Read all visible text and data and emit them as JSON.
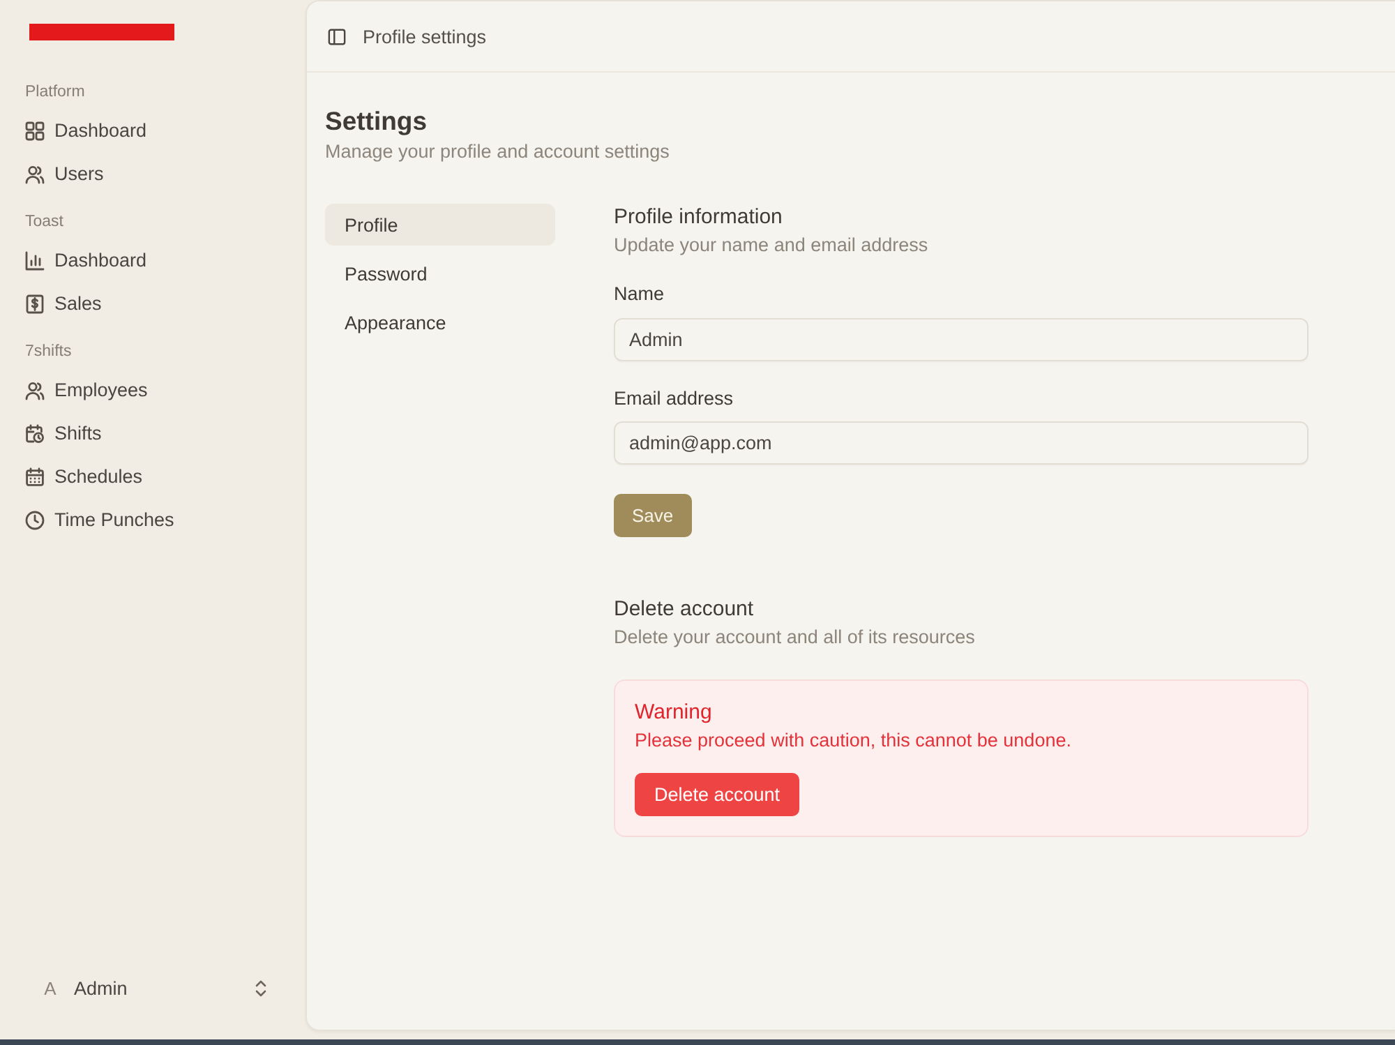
{
  "sidebar": {
    "groups": [
      {
        "label": "Platform",
        "items": [
          {
            "label": "Dashboard",
            "selected": false
          },
          {
            "label": "Users",
            "selected": false
          }
        ]
      },
      {
        "label": "Toast",
        "items": [
          {
            "label": "Dashboard",
            "selected": false
          },
          {
            "label": "Sales",
            "selected": false
          }
        ]
      },
      {
        "label": "7shifts",
        "items": [
          {
            "label": "Employees",
            "selected": false
          },
          {
            "label": "Shifts",
            "selected": false
          },
          {
            "label": "Schedules",
            "selected": false
          },
          {
            "label": "Time Punches",
            "selected": false
          }
        ]
      }
    ],
    "user": {
      "initial": "A",
      "name": "Admin"
    }
  },
  "header": {
    "title": "Profile settings"
  },
  "page": {
    "title": "Settings",
    "subtitle": "Manage your profile and account settings"
  },
  "settings_nav": [
    {
      "label": "Profile",
      "selected": true
    },
    {
      "label": "Password",
      "selected": false
    },
    {
      "label": "Appearance",
      "selected": false
    }
  ],
  "profile_section": {
    "title": "Profile information",
    "subtitle": "Update your name and email address",
    "fields": [
      {
        "label": "Name",
        "value": "Admin"
      },
      {
        "label": "Email address",
        "value": "admin@app.com"
      }
    ],
    "save_button": "Save"
  },
  "delete_section": {
    "title": "Delete account",
    "subtitle": "Delete your account and all of its resources",
    "warning": {
      "title": "Warning",
      "message": "Please proceed with caution, this cannot be undone.",
      "button": "Delete account"
    }
  }
}
